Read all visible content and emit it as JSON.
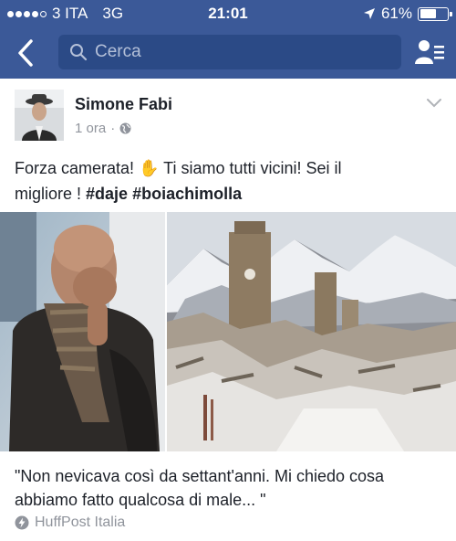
{
  "status_bar": {
    "carrier": "3 ITA",
    "network": "3G",
    "time": "21:01",
    "battery": "61%",
    "battery_level": 0.61,
    "signal_bars": 4,
    "signal_total": 5
  },
  "nav": {
    "search_placeholder": "Cerca",
    "back_icon": "chevron-left-icon",
    "friends_icon": "friend-requests-icon"
  },
  "post": {
    "author": "Simone Fabi",
    "time": "1 ora",
    "privacy_icon": "globe-icon",
    "text_line1_a": "Forza camerata!",
    "text_line1_b": " Ti siamo tutti vicini! Sei il",
    "text_line2_a": "migliore ! ",
    "hashtag1": "#daje",
    "hashtag2": "#boiachimolla",
    "wave_emoji": "✋"
  },
  "link": {
    "title": "\"Non nevicava così da settant'anni. Mi chiedo cosa abbiamo fatto qualcosa di male... \"",
    "source": "HuffPost Italia"
  },
  "colors": {
    "header_blue": "#3b5998",
    "search_bg": "#2b4a86",
    "meta_gray": "#90949c",
    "text": "#1d2129"
  }
}
